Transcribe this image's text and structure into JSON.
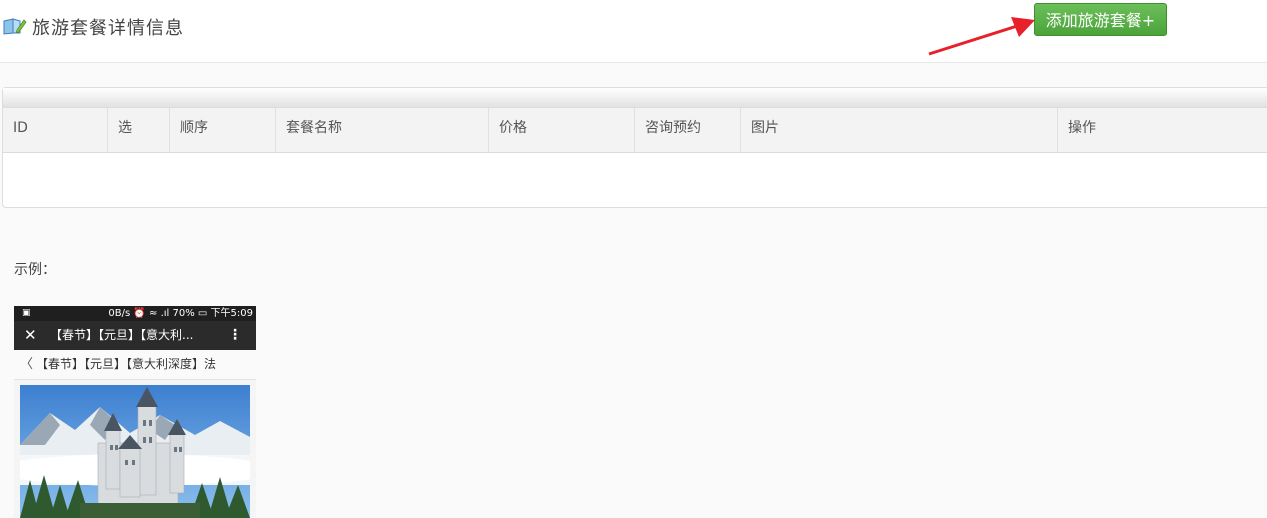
{
  "header": {
    "title": "旅游套餐详情信息",
    "icon": "book-edit-icon",
    "add_button_label": "添加旅游套餐+"
  },
  "annotation": {
    "arrow_color": "#e8202a"
  },
  "table": {
    "columns": [
      "ID",
      "选",
      "顺序",
      "套餐名称",
      "价格",
      "咨询预约",
      "图片",
      "操作"
    ],
    "rows": []
  },
  "example": {
    "label": "示例：",
    "phone": {
      "status_left": "▣",
      "status_right": "0B/s ⏰ ≈ .ıl 70% ▭ 下午5:09",
      "nav_close": "✕",
      "nav_title": "【春节】【元旦】【意大利...",
      "nav_more": "⋮",
      "sub_back": "〈",
      "sub_title": "【春节】【元旦】【意大利深度】法"
    }
  },
  "colors": {
    "button_green": "#5cb85c",
    "page_bg": "#fafafa"
  }
}
